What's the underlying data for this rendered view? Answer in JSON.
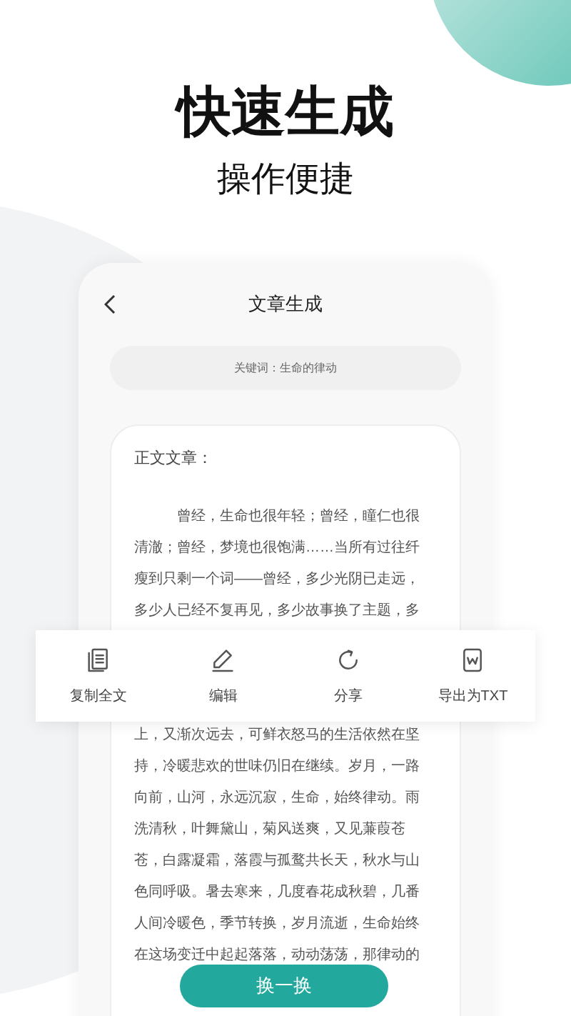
{
  "headline": "快速生成",
  "subheadline": "操作便捷",
  "screen": {
    "title": "文章生成",
    "keyword": "关键词：生命的律动",
    "article": {
      "heading": "正文文章：",
      "lines_above": [
        "曾经，生命也很年轻；曾经，瞳仁也很",
        "清澈；曾经，梦境也很饱满……当所有过往纤",
        "瘦到只剩一个词——曾经，多少光阴已走远，",
        "多少人已经不复再见，多少故事换了主题，多"
      ],
      "lines_below": [
        "上，又渐次远去，可鲜衣怒马的生活依然在坚",
        "持，冷暖悲欢的世味仍旧在继续。岁月，一路",
        "向前，山河，永远沉寂，生命，始终律动。雨",
        "洗清秋，叶舞黛山，菊风送爽，又见蒹葭苍",
        "苍，白露凝霜，落霞与孤鹜共长天，秋水与山",
        "色同呼吸。暑去寒来，几度春花成秋碧，几番",
        "人间冷暖色，季节转换，岁月流逝，生命始终",
        "在这场变迁中起起落落，动动荡荡，那律动的"
      ]
    },
    "toolbar": [
      {
        "kind": "copy",
        "label": "复制全文"
      },
      {
        "kind": "edit",
        "label": "编辑"
      },
      {
        "kind": "share",
        "label": "分享"
      },
      {
        "kind": "export",
        "label": "导出为TXT"
      }
    ],
    "refresh_button": "换一换"
  }
}
